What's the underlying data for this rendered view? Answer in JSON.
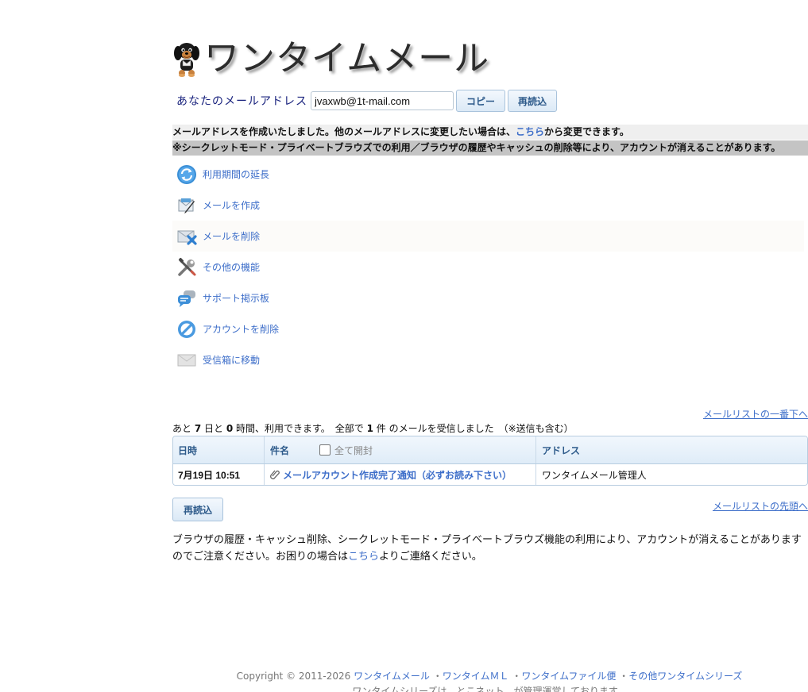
{
  "logo": {
    "text": "ワンタイムメール"
  },
  "address": {
    "label": "あなたのメールアドレス",
    "value": "jvaxwb@1t-mail.com",
    "copy_label": "コピー",
    "reload_label": "再読込"
  },
  "notice": {
    "line1_prefix": "メールアドレスを作成いたしました。他のメールアドレスに変更したい場合は、",
    "line1_link": "こちら",
    "line1_suffix": "から変更できます。",
    "line2": "※シークレットモード・プライベートブラウズでの利用／ブラウザの履歴やキャッシュの削除等により、アカウントが消えることがあります。"
  },
  "menu": [
    {
      "label": "利用期間の延長",
      "icon": "refresh-icon"
    },
    {
      "label": "メールを作成",
      "icon": "compose-icon"
    },
    {
      "label": "メールを削除",
      "icon": "delete-mail-icon"
    },
    {
      "label": "その他の機能",
      "icon": "tools-icon"
    },
    {
      "label": "サポート掲示板",
      "icon": "chat-icon"
    },
    {
      "label": "アカウントを削除",
      "icon": "prohibit-icon"
    },
    {
      "label": "受信箱に移動",
      "icon": "envelope-icon"
    }
  ],
  "maillist": {
    "to_bottom": "メールリストの一番下へ",
    "to_top": "メールリストの先頭へ",
    "summary": {
      "p1": "あと ",
      "days": "7",
      "p2": " 日と ",
      "hours": "0",
      "p3": " 時間、利用できます。　全部で ",
      "count": "1",
      "p4": " 件 のメールを受信しました　（※送信も含む）"
    },
    "headers": {
      "date": "日時",
      "subject": "件名",
      "open_all": "全て開封",
      "address": "アドレス"
    },
    "rows": [
      {
        "date": "7月19日 10:51",
        "subject": "メールアカウント作成完了通知（必ずお読み下さい）",
        "from": "ワンタイムメール管理人"
      }
    ],
    "reload_label": "再読込"
  },
  "footnote": {
    "text1": "ブラウザの履歴・キャッシュ削除、シークレットモード・プライベートブラウズ機能の利用により、アカウントが消えることがありますのでご注意ください。お困りの場合は",
    "link": "こちら",
    "text2": "よりご連絡ください。"
  },
  "footer": {
    "copyright": "Copyright © 2011-2026 ",
    "links": [
      "ワンタイムメール",
      "ワンタイムＭＬ",
      "ワンタイムファイル便",
      "その他ワンタイムシリーズ"
    ],
    "sep": " ・",
    "line2": "ワンタイムシリーズは、とこネット　が管理運営しております。"
  },
  "colors": {
    "link": "#3d6ec9",
    "header_blue": "#2d5a8a"
  }
}
